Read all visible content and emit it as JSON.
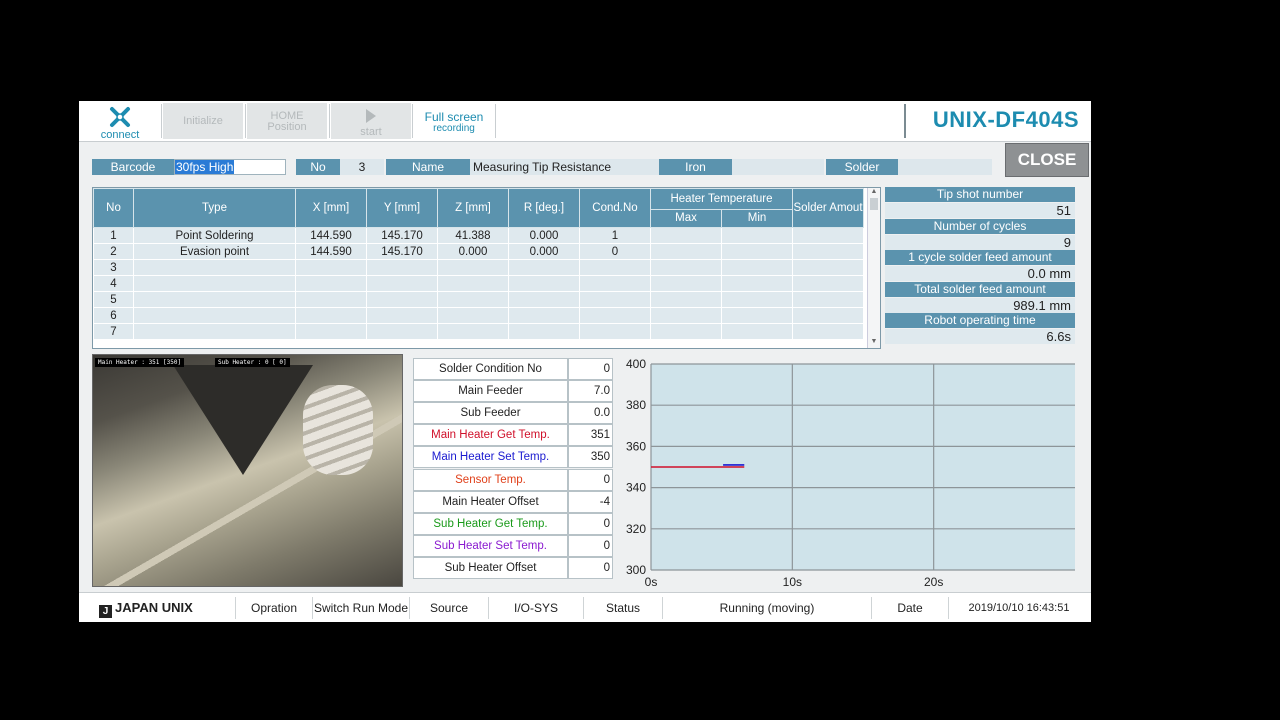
{
  "toolbar": {
    "connect": "connect",
    "initialize": "Initialize",
    "home_line1": "HOME",
    "home_line2": "Position",
    "start": "start",
    "fullscreen_line1": "Full screen",
    "fullscreen_line2": "recording"
  },
  "title": "UNIX-DF404S",
  "info": {
    "barcode_label": "Barcode",
    "barcode_value": "30fps High",
    "no_label": "No",
    "no_value": "3",
    "name_label": "Name",
    "name_value": "Measuring Tip Resistance",
    "iron_label": "Iron",
    "iron_value": "",
    "solder_label": "Solder",
    "solder_value": ""
  },
  "close_label": "CLOSE",
  "table": {
    "headers": {
      "no": "No",
      "type": "Type",
      "x": "X [mm]",
      "y": "Y [mm]",
      "z": "Z [mm]",
      "r": "R [deg.]",
      "cond": "Cond.No",
      "heater": "Heater Temperature",
      "max": "Max",
      "min": "Min",
      "solder": "Solder Amout"
    },
    "rows": [
      {
        "no": "1",
        "type": "Point Soldering",
        "x": "144.590",
        "y": "145.170",
        "z": "41.388",
        "r": "0.000",
        "cond": "1",
        "max": "",
        "min": "",
        "solder": ""
      },
      {
        "no": "2",
        "type": "Evasion point",
        "x": "144.590",
        "y": "145.170",
        "z": "0.000",
        "r": "0.000",
        "cond": "0",
        "max": "",
        "min": "",
        "solder": ""
      },
      {
        "no": "3",
        "type": "",
        "x": "",
        "y": "",
        "z": "",
        "r": "",
        "cond": "",
        "max": "",
        "min": "",
        "solder": ""
      },
      {
        "no": "4",
        "type": "",
        "x": "",
        "y": "",
        "z": "",
        "r": "",
        "cond": "",
        "max": "",
        "min": "",
        "solder": ""
      },
      {
        "no": "5",
        "type": "",
        "x": "",
        "y": "",
        "z": "",
        "r": "",
        "cond": "",
        "max": "",
        "min": "",
        "solder": ""
      },
      {
        "no": "6",
        "type": "",
        "x": "",
        "y": "",
        "z": "",
        "r": "",
        "cond": "",
        "max": "",
        "min": "",
        "solder": ""
      },
      {
        "no": "7",
        "type": "",
        "x": "",
        "y": "",
        "z": "",
        "r": "",
        "cond": "",
        "max": "",
        "min": "",
        "solder": ""
      }
    ]
  },
  "stats": [
    {
      "label": "Tip shot number",
      "value": "51"
    },
    {
      "label": "Number of cycles",
      "value": "9"
    },
    {
      "label": "1 cycle solder feed amount",
      "value": "0.0 mm"
    },
    {
      "label": "Total solder feed amount",
      "value": "989.1 mm"
    },
    {
      "label": "Robot operating time",
      "value": "6.6s"
    }
  ],
  "camera": {
    "tag_main": "Main Heater : 351 [350]",
    "tag_sub": "Sub Heater :   0 [  0]"
  },
  "params": [
    {
      "label": "Solder Condition No",
      "value": "0",
      "color": "#222222"
    },
    {
      "label": "Main Feeder",
      "value": "7.0",
      "color": "#222222"
    },
    {
      "label": "Sub Feeder",
      "value": "0.0",
      "color": "#222222"
    },
    {
      "label": "Main Heater Get Temp.",
      "value": "351",
      "color": "#d0102a"
    },
    {
      "label": "Main Heater Set Temp.",
      "value": "350",
      "color": "#1a1ad0"
    },
    {
      "label": "Sensor Temp.",
      "value": "0",
      "color": "#e0401a"
    },
    {
      "label": "Main Heater Offset",
      "value": "-4",
      "color": "#222222"
    },
    {
      "label": "Sub Heater Get Temp.",
      "value": "0",
      "color": "#1a9a1a"
    },
    {
      "label": "Sub Heater Set Temp.",
      "value": "0",
      "color": "#8a1ad0"
    },
    {
      "label": "Sub Heater Offset",
      "value": "0",
      "color": "#222222"
    }
  ],
  "chart_data": {
    "type": "line",
    "y_ticks": [
      "400",
      "380",
      "360",
      "340",
      "320",
      "300"
    ],
    "x_ticks": [
      "0s",
      "10s",
      "20s"
    ],
    "ylim": [
      300,
      400
    ],
    "xlim": [
      0,
      30
    ],
    "series": [
      {
        "color": "#d0102a",
        "x": [
          0,
          6.6
        ],
        "y": [
          350,
          350
        ]
      },
      {
        "color": "#1a1ad0",
        "x": [
          5.1,
          6.6
        ],
        "y": [
          351,
          351
        ]
      }
    ],
    "grid": true
  },
  "statusbar": {
    "brand": "JAPAN UNIX",
    "opration": "Opration",
    "switch_mode": "Switch Run Mode",
    "source": "Source",
    "io": "I/O-SYS",
    "status_label": "Status",
    "status_value": "Running (moving)",
    "date_label": "Date",
    "date_value": "2019/10/10 16:43:51"
  },
  "colors": {
    "accent": "#1d8cb0",
    "header_blue": "#5b93ae",
    "cell_bg": "#dfe9ee",
    "chart_bg": "#cfe3ea"
  }
}
